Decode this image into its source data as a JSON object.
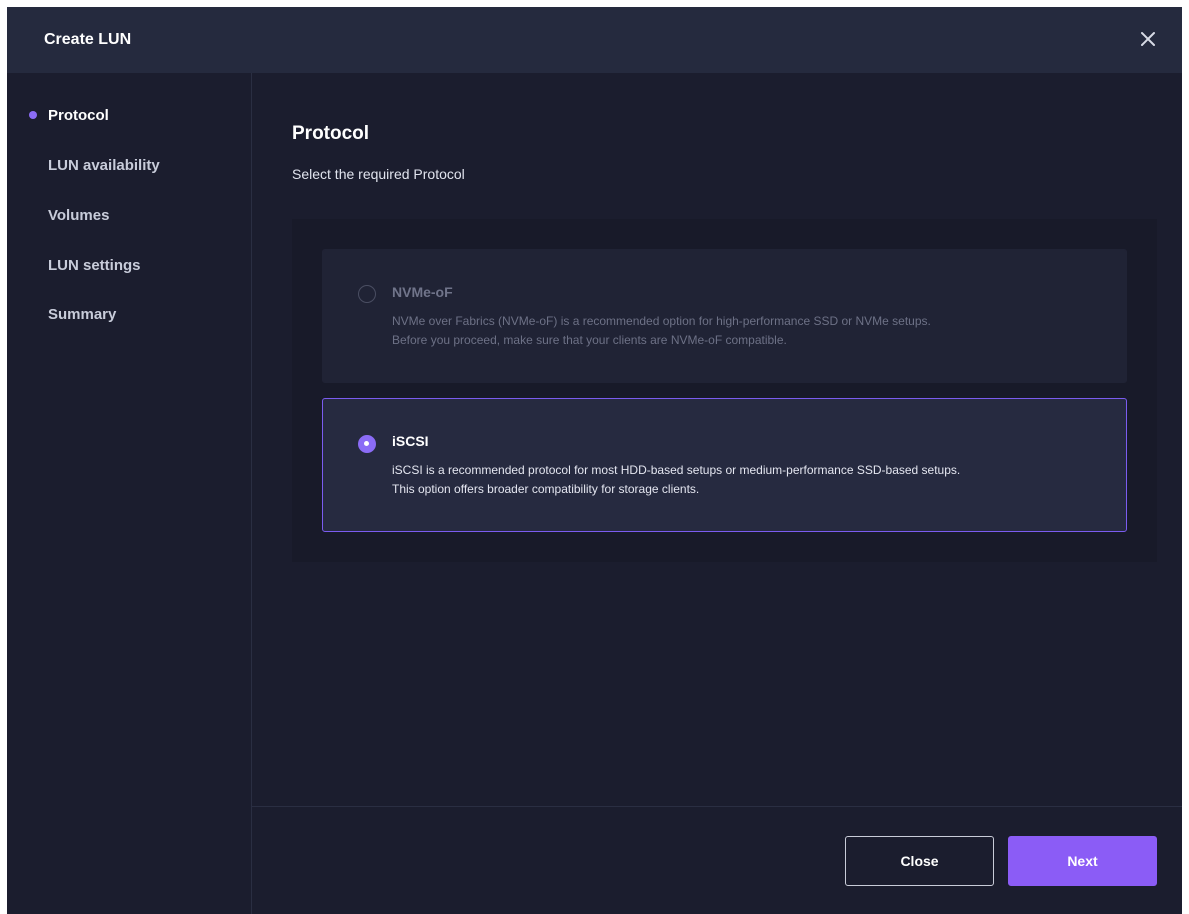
{
  "dialog": {
    "title": "Create LUN",
    "close_icon": "close-icon"
  },
  "sidebar": {
    "steps": [
      {
        "label": "Protocol",
        "active": true
      },
      {
        "label": "LUN availability",
        "active": false
      },
      {
        "label": "Volumes",
        "active": false
      },
      {
        "label": "LUN settings",
        "active": false
      },
      {
        "label": "Summary",
        "active": false
      }
    ]
  },
  "main": {
    "title": "Protocol",
    "subtitle": "Select the required Protocol",
    "options": [
      {
        "name": "NVMe-oF",
        "description_line1": "NVMe over Fabrics (NVMe-oF) is a recommended option for high-performance SSD or NVMe setups.",
        "description_line2": "Before you proceed, make sure that your clients are NVMe-oF compatible.",
        "selected": false,
        "disabled": true
      },
      {
        "name": "iSCSI",
        "description_line1": "iSCSI is a recommended protocol for most HDD-based setups or medium-performance SSD-based setups.",
        "description_line2": "This option offers broader compatibility for storage clients.",
        "selected": true,
        "disabled": false
      }
    ]
  },
  "footer": {
    "close_label": "Close",
    "next_label": "Next"
  },
  "colors": {
    "accent": "#8b5cf6",
    "background": "#1b1d2e",
    "header": "#252a3e"
  }
}
